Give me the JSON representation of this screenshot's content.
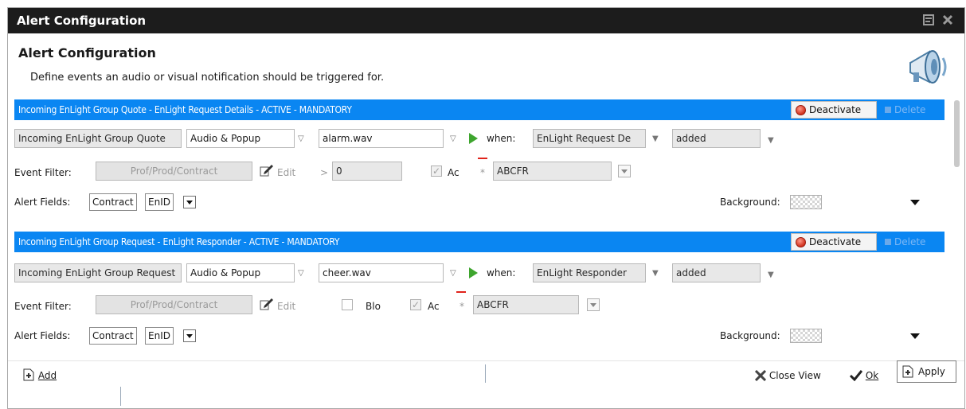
{
  "window": {
    "title": "Alert Configuration"
  },
  "header": {
    "title": "Alert Configuration",
    "description": "Define events an audio or visual notification should be triggered for."
  },
  "alerts": [
    {
      "bar_label": "Incoming EnLight Group Quote - EnLight Request Details - ACTIVE - MANDATORY",
      "deactivate": "Deactivate",
      "delete": "Delete",
      "event_name": "Incoming EnLight Group Quote",
      "notify_type": "Audio & Popup",
      "sound": "alarm.wav",
      "when_label": "when:",
      "when_source": "EnLight Request De",
      "when_action": "added",
      "filter_label": "Event Filter:",
      "filter_value": "Prof/Prod/Contract",
      "edit_label": "Edit",
      "operator": ">",
      "threshold": "0",
      "ac_label": "Ac",
      "code": "ABCFR",
      "fields_label": "Alert Fields:",
      "field_1": "Contract",
      "field_2": "EnID",
      "background_label": "Background:"
    },
    {
      "bar_label": "Incoming EnLight Group Request - EnLight Responder - ACTIVE - MANDATORY",
      "deactivate": "Deactivate",
      "delete": "Delete",
      "event_name": "Incoming EnLight Group Request",
      "notify_type": "Audio & Popup",
      "sound": "cheer.wav",
      "when_label": "when:",
      "when_source": "EnLight Responder",
      "when_action": "added",
      "filter_label": "Event Filter:",
      "filter_value": "Prof/Prod/Contract",
      "edit_label": "Edit",
      "blo_label": "Blo",
      "ac_label": "Ac",
      "code": "ABCFR",
      "fields_label": "Alert Fields:",
      "field_1": "Contract",
      "field_2": "EnID",
      "background_label": "Background:"
    }
  ],
  "footer": {
    "add": "Add",
    "close_view": "Close View",
    "ok": "Ok",
    "apply": "Apply"
  },
  "colors": {
    "section_bar": "#0a86f2",
    "titlebar": "#1c1c1c",
    "play": "#3ea52e",
    "deactivate_icon": "#d0301c"
  },
  "icons": [
    "dock-icon",
    "close-icon",
    "megaphone-icon",
    "stop-icon",
    "play-icon",
    "edit-icon",
    "add-icon",
    "close-view-icon",
    "check-icon",
    "apply-icon"
  ]
}
